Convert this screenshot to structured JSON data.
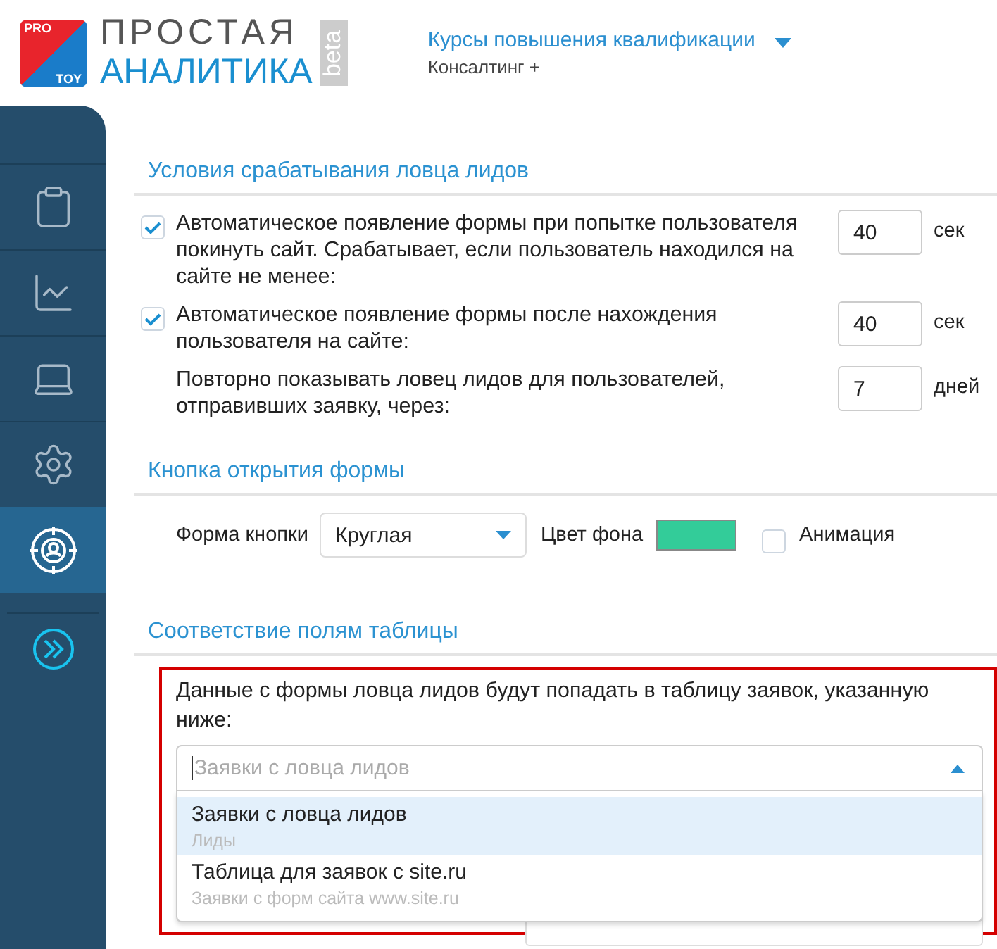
{
  "logo": {
    "badge_top": "PRO",
    "badge_bottom": "TOY",
    "line_1": "ПРОСТАЯ",
    "line_2": "АНАЛИТИКА",
    "tag": "beta"
  },
  "project": {
    "title": "Курсы повышения квалификации",
    "subtitle": "Консалтинг +"
  },
  "sidebar": {
    "items": [
      {
        "selected": false
      },
      {
        "selected": false
      },
      {
        "selected": false
      },
      {
        "selected": false
      },
      {
        "selected": true
      }
    ]
  },
  "sections": [
    {
      "title": "Условия срабатывания ловца лидов",
      "rows": [
        {
          "kind": "checkbox",
          "checked": true,
          "text": "Автоматическое появление формы при попытке пользователя покинуть сайт. Срабатывает, если пользователь находился на сайте не менее:",
          "value": "40",
          "unit": "сек"
        },
        {
          "kind": "checkbox",
          "checked": true,
          "text": "Автоматическое появление формы после нахождения пользователя на сайте:",
          "value": "40",
          "unit": "сек"
        },
        {
          "kind": "plain",
          "text": "Повторно показывать ловец лидов для пользователей, отправивших заявку, через:",
          "value": "7",
          "unit": "дней"
        }
      ]
    },
    {
      "title": "Кнопка открытия формы",
      "shape_label": "Форма кнопки",
      "shape_value": "Круглая",
      "color_label": "Цвет фона",
      "color": "#33cc99",
      "animation": {
        "label": "Анимация",
        "checked": false
      }
    },
    {
      "title": "Соответствие полям таблицы",
      "description": "Данные с формы ловца лидов будут попадать в таблицу заявок, указанную ниже:",
      "combo_placeholder": "Заявки с ловца лидов",
      "options": [
        {
          "title": "Заявки с ловца лидов",
          "subtitle": "Лиды",
          "selected": true
        },
        {
          "title": "Таблица для заявок с site.ru",
          "subtitle": "Заявки с форм сайта www.site.ru",
          "selected": false
        }
      ]
    }
  ]
}
